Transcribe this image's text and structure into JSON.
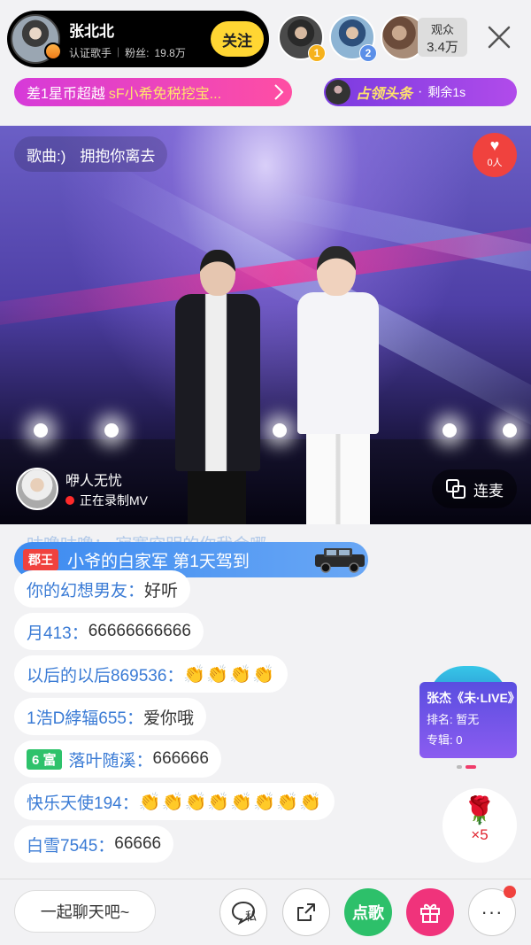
{
  "host": {
    "name": "张北北",
    "title": "认证歌手",
    "fans_label": "粉丝:",
    "fans_count": "19.8万",
    "follow_label": "关注"
  },
  "top_fans": [
    {
      "rank": "1"
    },
    {
      "rank": "2"
    },
    {
      "rank": ""
    }
  ],
  "viewers": {
    "label": "观众",
    "count": "3.4万"
  },
  "rank_ticker": {
    "text": "差1星币超越",
    "highlight": "sF小希免税挖宝..."
  },
  "headline": {
    "title": "占领头条",
    "dot": "·",
    "remaining": "剩余1s"
  },
  "video": {
    "song_prefix": "歌曲:)",
    "song_name": "拥抱你离去",
    "like_count": "0人",
    "recorder_name": "咿人无忧",
    "recorder_status": "正在录制MV",
    "link_label": "连麦"
  },
  "chat": {
    "faded_text": "咕噜咕噜：    寂寞空明的你我会哪",
    "entry_banner": {
      "badge": "郡王",
      "text": "小爷的白家军 第1天驾到"
    },
    "messages": [
      {
        "user": "你的幻想男友：",
        "text": "好听"
      },
      {
        "user": "月413：",
        "text": "66666666666"
      },
      {
        "user": "以后的以后869536：",
        "text": "👏👏👏👏"
      },
      {
        "user": "1浩D綍辐655：",
        "text": "爱你哦"
      },
      {
        "badge": "6 富",
        "user": "落叶随溪：",
        "text": "666666"
      },
      {
        "user": "快乐天使194：",
        "text": "👏👏👏👏👏👏👏👏"
      },
      {
        "user": "白雪7545：",
        "text": "66666"
      }
    ]
  },
  "album_card": {
    "title": "张杰《未·LIVE》",
    "rank_label": "排名:",
    "rank_value": "暂无",
    "album_label": "专辑:",
    "album_value": "0"
  },
  "rose_gift": {
    "count": "×5"
  },
  "bottom_bar": {
    "chat_placeholder": "一起聊天吧~",
    "private_label": "私",
    "request_song_label": "点歌",
    "more_label": "···"
  },
  "colors": {
    "follow": "#ffd633",
    "username": "#3a7bd5",
    "request_song": "#2dc06a",
    "gift": "#f0337b",
    "alert": "#f0423e"
  }
}
